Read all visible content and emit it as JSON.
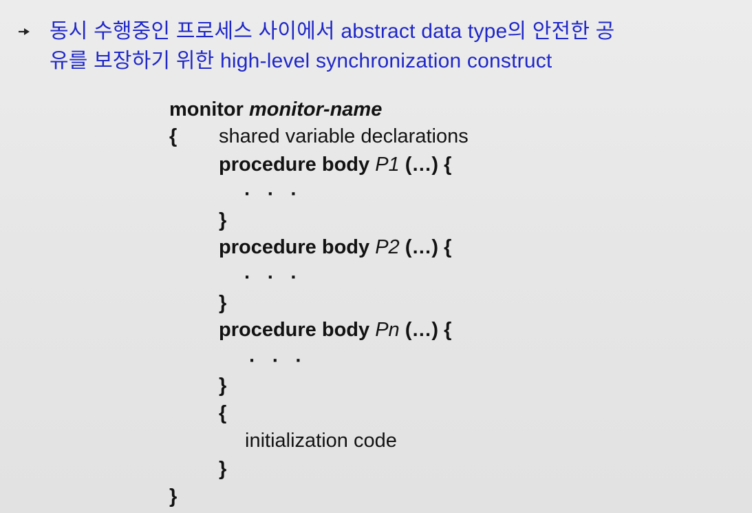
{
  "bullet": {
    "icon": "arrow-bullet-icon",
    "line1": "동시 수행중인 프로세스 사이에서 abstract data type의 안전한 공",
    "line2": "유를 보장하기 위한 high-level synchronization construct"
  },
  "code": {
    "monitor_keyword": "monitor",
    "monitor_name": "monitor-name",
    "open_brace": "{",
    "shared_decl": "shared variable declarations",
    "procedures": [
      {
        "keyword": "procedure body",
        "name": "P1",
        "params": "(…) {",
        "body": "· · ·",
        "close": "}"
      },
      {
        "keyword": "procedure body",
        "name": "P2",
        "params": "(…) {",
        "body": "· · ·",
        "close": "}"
      },
      {
        "keyword": "procedure body",
        "name": "Pn",
        "params": "(…) {",
        "body": "· · ·",
        "close": "}"
      }
    ],
    "init_open": "{",
    "init_code": "initialization code",
    "init_close": "}",
    "close_brace": "}"
  },
  "colors": {
    "background": "#e7e7e7",
    "bullet_text": "#1f27c8",
    "code_text": "#121212"
  }
}
